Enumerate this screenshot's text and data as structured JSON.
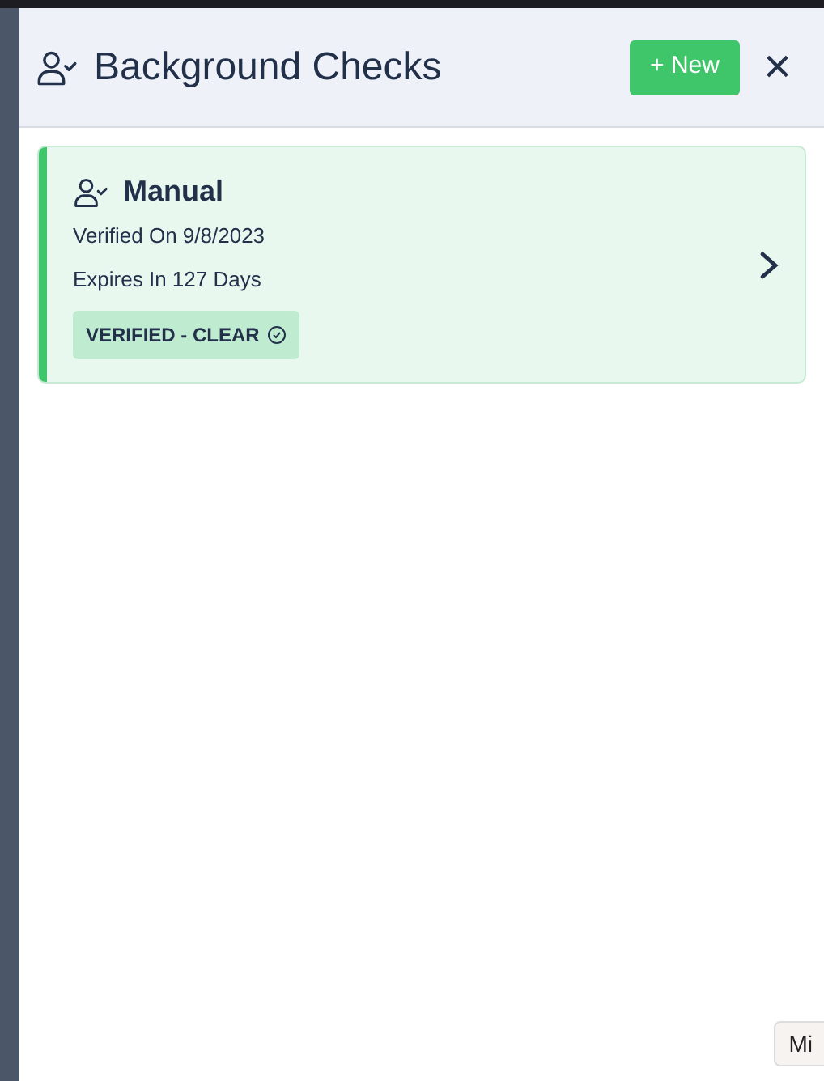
{
  "header": {
    "title": "Background Checks",
    "new_button": "+ New",
    "close": "×"
  },
  "checks": [
    {
      "title": "Manual",
      "verified_on": "Verified On 9/8/2023",
      "expires": "Expires In 127 Days",
      "status": "VERIFIED - CLEAR",
      "color": "#3fc56a"
    }
  ],
  "corner_button": "Mi"
}
